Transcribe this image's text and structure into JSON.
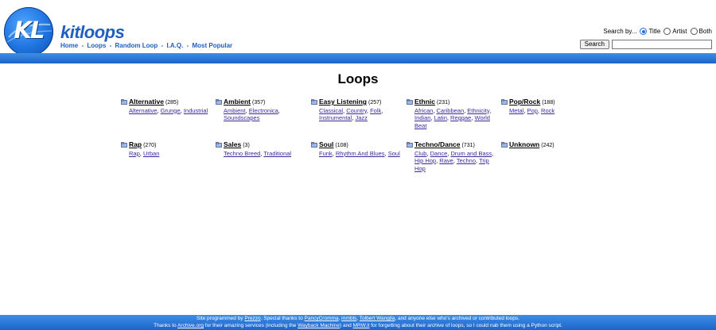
{
  "site": {
    "logo_text": "KL",
    "name": "kitloops"
  },
  "nav": [
    {
      "label": "Home"
    },
    {
      "label": "Loops"
    },
    {
      "label": "Random Loop"
    },
    {
      "label": "I.A.Q."
    },
    {
      "label": "Most Popular"
    }
  ],
  "nav_separator": "-",
  "search": {
    "label": "Search by...",
    "options": [
      "Title",
      "Artist",
      "Both"
    ],
    "selected": "Title",
    "button": "Search",
    "value": ""
  },
  "page_title": "Loops",
  "categories": [
    {
      "name": "Alternative",
      "count": "(285)",
      "subs": [
        "Alternative",
        "Grunge",
        "Industrial"
      ]
    },
    {
      "name": "Ambient",
      "count": "(357)",
      "subs": [
        "Ambient",
        "Electronica",
        "Soundscapes"
      ]
    },
    {
      "name": "Easy Listening",
      "count": "(257)",
      "subs": [
        "Classical",
        "Country",
        "Folk",
        "Instrumental",
        "Jazz"
      ]
    },
    {
      "name": "Ethnic",
      "count": "(231)",
      "subs": [
        "African",
        "Caribbean",
        "Ethnicity",
        "Indian",
        "Latin",
        "Reggae",
        "World Beat"
      ]
    },
    {
      "name": "Pop/Rock",
      "count": "(188)",
      "subs": [
        "Metal",
        "Pop",
        "Rock"
      ]
    },
    {
      "name": "Rap",
      "count": "(270)",
      "subs": [
        "Rap",
        "Urban"
      ]
    },
    {
      "name": "Sales",
      "count": "(3)",
      "subs": [
        "Techno Breed",
        "Traditional"
      ]
    },
    {
      "name": "Soul",
      "count": "(108)",
      "subs": [
        "Funk",
        "Rhythm And Blues",
        "Soul"
      ]
    },
    {
      "name": "Techno/Dance",
      "count": "(731)",
      "subs": [
        "Club",
        "Dance",
        "Drum and Bass",
        "Hip Hop",
        "Rave",
        "Techno",
        "Trip Hop"
      ]
    },
    {
      "name": "Unknown",
      "count": "(242)",
      "subs": []
    }
  ],
  "footer": {
    "l1_a": "Site programmed by ",
    "l1_link1": "Prezzo",
    "l1_b": ". Special thanks to ",
    "l1_link2": "PancyCromma",
    "l1_c": ", ",
    "l1_link3": "mmbls",
    "l1_d": ", ",
    "l1_link4": "Tolbert Wangila",
    "l1_e": ", and anyone else who's archived or contributed loops.",
    "l2_a": "Thanks to ",
    "l2_link1": "Archive.org",
    "l2_b": " for their amazing services (including the ",
    "l2_link2": "Wayback Machine",
    "l2_c": ") and ",
    "l2_link3": "MRW.it",
    "l2_d": " for forgetting about their archive of loops, so I could nab them using a Python script."
  },
  "colors": {
    "accent": "#1e5fc0",
    "band": "#2a78dc",
    "link": "#1a1aa6"
  }
}
